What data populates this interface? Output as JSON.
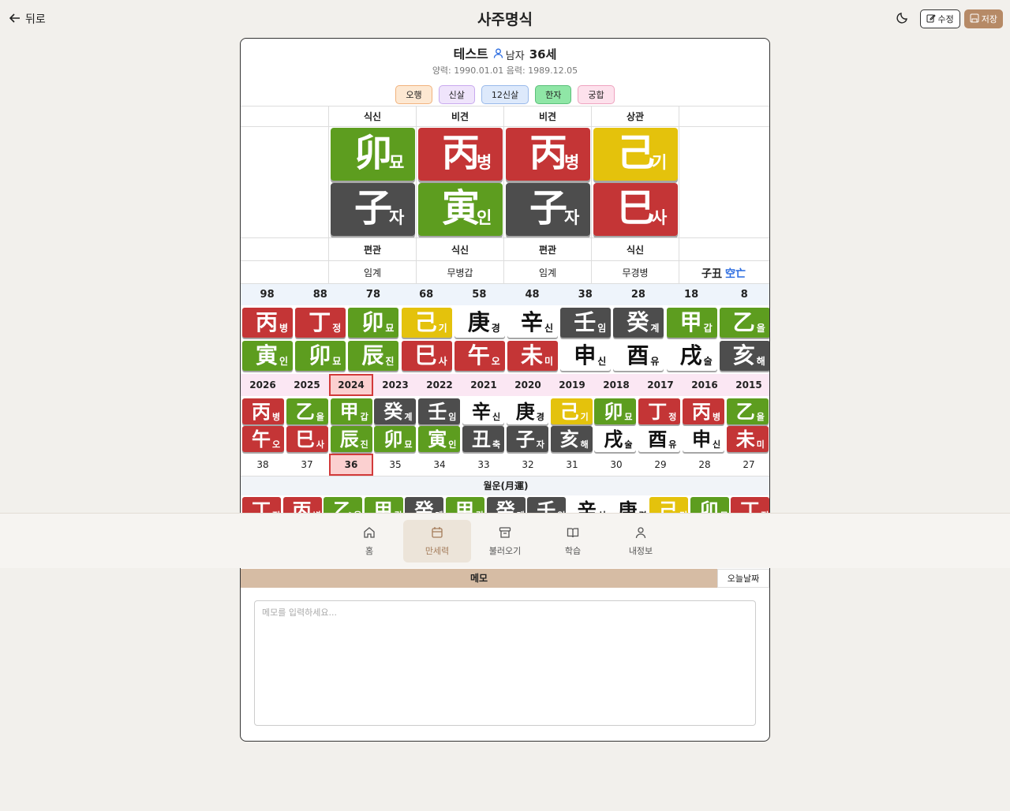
{
  "header": {
    "back_label": "뒤로",
    "title": "사주명식",
    "edit_label": "수정",
    "save_label": "저장"
  },
  "profile": {
    "name": "테스트",
    "gender": "남자",
    "age": "36세",
    "dates": "양력: 1990.01.01 음력: 1989.12.05"
  },
  "chips": [
    {
      "label": "오행",
      "bg": "#fde8d2",
      "border": "#f1b27c"
    },
    {
      "label": "신살",
      "bg": "#efe4fb",
      "border": "#c8a9ee"
    },
    {
      "label": "12신살",
      "bg": "#dde9fb",
      "border": "#99b9ea"
    },
    {
      "label": "한자",
      "bg": "#8fe6a6",
      "border": "#5bbf7a"
    },
    {
      "label": "궁합",
      "bg": "#fde1ec",
      "border": "#eea3bf"
    }
  ],
  "pillars": {
    "top_labels": [
      "",
      "식신",
      "비견",
      "비견",
      "상관",
      ""
    ],
    "stems": [
      {
        "h": "卯",
        "k": "묘",
        "el": "wood"
      },
      {
        "h": "丙",
        "k": "병",
        "el": "fire"
      },
      {
        "h": "丙",
        "k": "병",
        "el": "fire"
      },
      {
        "h": "己",
        "k": "기",
        "el": "earth"
      }
    ],
    "branches": [
      {
        "h": "子",
        "k": "자",
        "el": "water"
      },
      {
        "h": "寅",
        "k": "인",
        "el": "wood"
      },
      {
        "h": "子",
        "k": "자",
        "el": "water"
      },
      {
        "h": "巳",
        "k": "사",
        "el": "fire"
      }
    ],
    "bottom_labels": [
      "",
      "편관",
      "식신",
      "편관",
      "식신",
      ""
    ],
    "hidden_stems": [
      "",
      "임계",
      "무병갑",
      "임계",
      "무경병",
      ""
    ],
    "kongmang": "子丑",
    "kongmang_label": "空亡"
  },
  "daeun": {
    "ages": [
      "98",
      "88",
      "78",
      "68",
      "58",
      "48",
      "38",
      "28",
      "18",
      "8"
    ],
    "stems": [
      {
        "h": "丙",
        "k": "병",
        "el": "fire"
      },
      {
        "h": "丁",
        "k": "정",
        "el": "fire"
      },
      {
        "h": "卯",
        "k": "묘",
        "el": "wood"
      },
      {
        "h": "己",
        "k": "기",
        "el": "earth"
      },
      {
        "h": "庚",
        "k": "경",
        "el": "metal"
      },
      {
        "h": "辛",
        "k": "신",
        "el": "metal"
      },
      {
        "h": "壬",
        "k": "임",
        "el": "water"
      },
      {
        "h": "癸",
        "k": "계",
        "el": "water"
      },
      {
        "h": "甲",
        "k": "갑",
        "el": "wood"
      },
      {
        "h": "乙",
        "k": "을",
        "el": "wood"
      }
    ],
    "branches": [
      {
        "h": "寅",
        "k": "인",
        "el": "wood"
      },
      {
        "h": "卯",
        "k": "묘",
        "el": "wood"
      },
      {
        "h": "辰",
        "k": "진",
        "el": "wood"
      },
      {
        "h": "巳",
        "k": "사",
        "el": "fire"
      },
      {
        "h": "午",
        "k": "오",
        "el": "fire"
      },
      {
        "h": "未",
        "k": "미",
        "el": "fire"
      },
      {
        "h": "申",
        "k": "신",
        "el": "metal"
      },
      {
        "h": "酉",
        "k": "유",
        "el": "metal"
      },
      {
        "h": "戌",
        "k": "술",
        "el": "metal"
      },
      {
        "h": "亥",
        "k": "해",
        "el": "water"
      }
    ]
  },
  "seun": {
    "years": [
      "2026",
      "2025",
      "2024",
      "2023",
      "2022",
      "2021",
      "2020",
      "2019",
      "2018",
      "2017",
      "2016",
      "2015"
    ],
    "selected_index": 2,
    "stems": [
      {
        "h": "丙",
        "k": "병",
        "el": "fire"
      },
      {
        "h": "乙",
        "k": "을",
        "el": "wood"
      },
      {
        "h": "甲",
        "k": "갑",
        "el": "wood"
      },
      {
        "h": "癸",
        "k": "계",
        "el": "water"
      },
      {
        "h": "壬",
        "k": "임",
        "el": "water"
      },
      {
        "h": "辛",
        "k": "신",
        "el": "metal"
      },
      {
        "h": "庚",
        "k": "경",
        "el": "metal"
      },
      {
        "h": "己",
        "k": "기",
        "el": "earth"
      },
      {
        "h": "卯",
        "k": "묘",
        "el": "wood"
      },
      {
        "h": "丁",
        "k": "정",
        "el": "fire"
      },
      {
        "h": "丙",
        "k": "병",
        "el": "fire"
      },
      {
        "h": "乙",
        "k": "을",
        "el": "wood"
      }
    ],
    "branches": [
      {
        "h": "午",
        "k": "오",
        "el": "fire"
      },
      {
        "h": "巳",
        "k": "사",
        "el": "fire"
      },
      {
        "h": "辰",
        "k": "진",
        "el": "wood"
      },
      {
        "h": "卯",
        "k": "묘",
        "el": "wood"
      },
      {
        "h": "寅",
        "k": "인",
        "el": "wood"
      },
      {
        "h": "丑",
        "k": "축",
        "el": "water"
      },
      {
        "h": "子",
        "k": "자",
        "el": "water"
      },
      {
        "h": "亥",
        "k": "해",
        "el": "water"
      },
      {
        "h": "戌",
        "k": "술",
        "el": "metal"
      },
      {
        "h": "酉",
        "k": "유",
        "el": "metal"
      },
      {
        "h": "申",
        "k": "신",
        "el": "metal"
      },
      {
        "h": "未",
        "k": "미",
        "el": "fire"
      }
    ],
    "ages": [
      "38",
      "37",
      "36",
      "35",
      "34",
      "33",
      "32",
      "31",
      "30",
      "29",
      "28",
      "27"
    ]
  },
  "wolun": {
    "title": "월운(月運)",
    "stems": [
      {
        "h": "丁",
        "k": "정",
        "el": "fire"
      },
      {
        "h": "丙",
        "k": "병",
        "el": "fire"
      },
      {
        "h": "乙",
        "k": "을",
        "el": "wood"
      },
      {
        "h": "甲",
        "k": "갑",
        "el": "wood"
      },
      {
        "h": "癸",
        "k": "계",
        "el": "water"
      },
      {
        "h": "甲",
        "k": "갑",
        "el": "wood"
      },
      {
        "h": "癸",
        "k": "계",
        "el": "water"
      },
      {
        "h": "壬",
        "k": "임",
        "el": "water"
      },
      {
        "h": "辛",
        "k": "신",
        "el": "metal"
      },
      {
        "h": "庚",
        "k": "경",
        "el": "metal"
      },
      {
        "h": "己",
        "k": "기",
        "el": "earth"
      },
      {
        "h": "卯",
        "k": "묘",
        "el": "wood"
      },
      {
        "h": "丁",
        "k": "정",
        "el": "fire"
      }
    ]
  },
  "memo": {
    "title": "메모",
    "today_label": "오늘날짜",
    "placeholder": "메모를 입력하세요..."
  },
  "nav": {
    "items": [
      {
        "label": "홈",
        "icon": "home-icon"
      },
      {
        "label": "만세력",
        "icon": "calendar-icon"
      },
      {
        "label": "불러오기",
        "icon": "archive-icon"
      },
      {
        "label": "학습",
        "icon": "book-icon"
      },
      {
        "label": "내정보",
        "icon": "user-icon"
      }
    ],
    "active_index": 1
  }
}
